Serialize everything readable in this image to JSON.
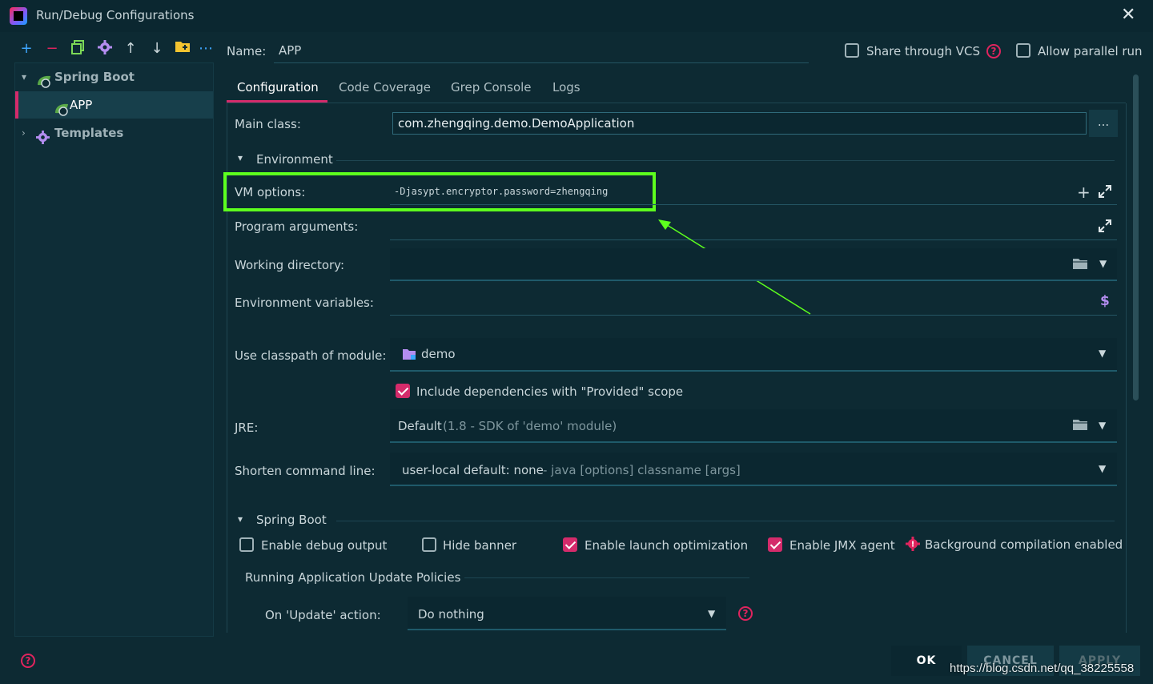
{
  "window": {
    "title": "Run/Debug Configurations"
  },
  "toolbar": {
    "add": "+",
    "remove": "−",
    "more": "⋯"
  },
  "tree": {
    "spring_boot": "Spring Boot",
    "app": "APP",
    "templates": "Templates"
  },
  "header": {
    "name_label": "Name:",
    "name_value": "APP",
    "share_vcs": "Share through VCS",
    "allow_parallel": "Allow parallel run"
  },
  "tabs": [
    {
      "label": "Configuration"
    },
    {
      "label": "Code Coverage"
    },
    {
      "label": "Grep Console"
    },
    {
      "label": "Logs"
    }
  ],
  "config": {
    "main_class_label": "Main class:",
    "main_class_value": "com.zhengqing.demo.DemoApplication",
    "browse": "...",
    "environment_label": "Environment",
    "vm_options_label": "VM options:",
    "vm_options_value": "-Djasypt.encryptor.password=zhengqing",
    "program_args_label": "Program arguments:",
    "working_dir_label": "Working directory:",
    "env_vars_label": "Environment variables:",
    "env_vars_icon": "$",
    "classpath_label": "Use classpath of module:",
    "classpath_value": "demo",
    "include_provided": "Include dependencies with \"Provided\" scope",
    "jre_label": "JRE:",
    "jre_value": "Default",
    "jre_detail": "(1.8 - SDK of 'demo' module)",
    "shorten_label": "Shorten command line:",
    "shorten_value": "user-local default: none",
    "shorten_detail": "- java [options] classname [args]"
  },
  "spring_boot": {
    "section_label": "Spring Boot",
    "enable_debug": "Enable debug output",
    "hide_banner": "Hide banner",
    "launch_opt": "Enable launch optimization",
    "jmx": "Enable JMX agent",
    "background": "Background compilation enabled",
    "policies_label": "Running Application Update Policies",
    "update_label": "On 'Update' action:",
    "update_value": "Do nothing"
  },
  "buttons": {
    "ok": "OK",
    "cancel": "CANCEL",
    "apply": "APPLY"
  },
  "watermark": "https://blog.csdn.net/qq_38225558",
  "colors": {
    "accent": "#d42b6b",
    "highlight": "#5dff1e",
    "background": "#0d2a33"
  }
}
